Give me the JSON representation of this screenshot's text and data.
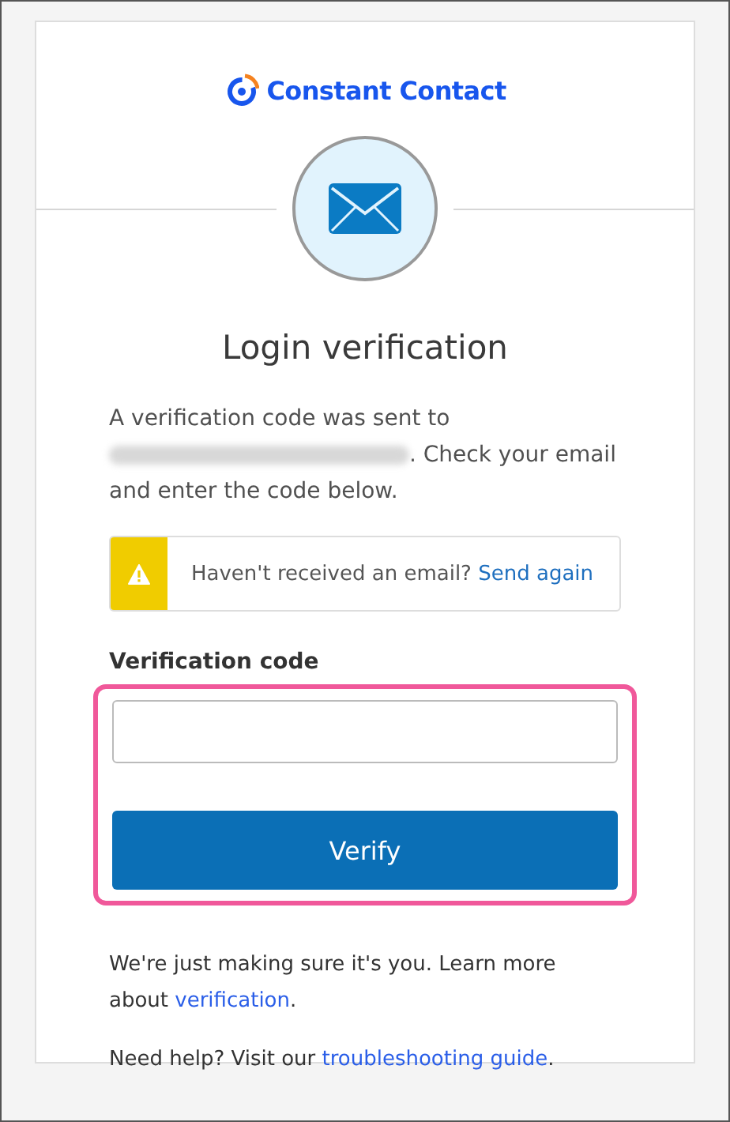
{
  "logo": {
    "text": "Constant Contact"
  },
  "title": "Login verification",
  "intro": {
    "before": "A verification code was sent to",
    "after": ". Check your email and enter the code below.",
    "email_redacted": true
  },
  "alert": {
    "text": "Haven't received an email?",
    "link": "Send again"
  },
  "field": {
    "label": "Verification code"
  },
  "button": "Verify",
  "footer": [
    {
      "before": "We're just making sure it's you. Learn more about ",
      "link": "verification",
      "after": "."
    },
    {
      "before": "Need help? Visit our ",
      "link": "troubleshooting guide",
      "after": "."
    }
  ]
}
